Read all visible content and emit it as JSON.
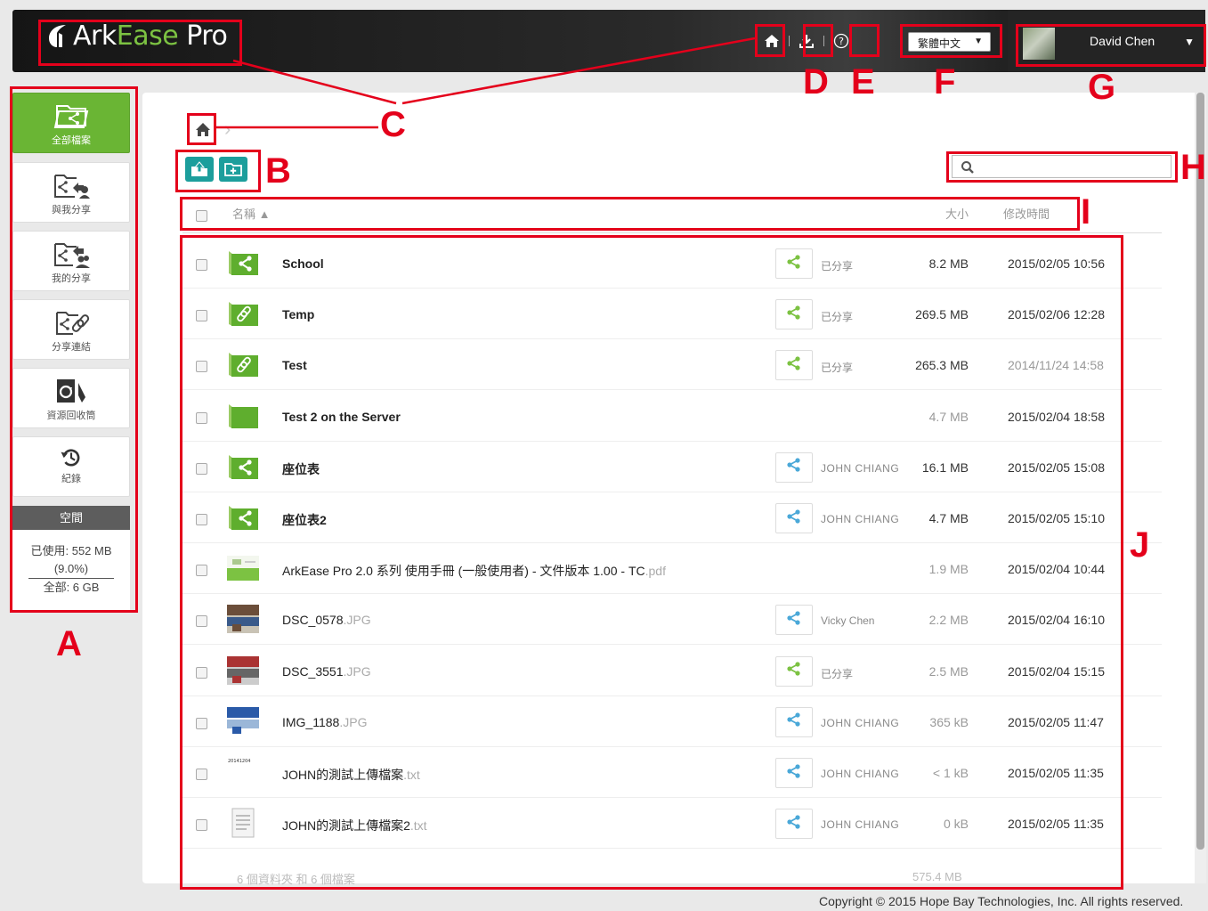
{
  "header": {
    "logo_text_a": "Ark",
    "logo_text_b": "Ease",
    "logo_text_c": "Pro",
    "language": "繁體中文",
    "user_name": "David Chen",
    "icons": [
      "home-icon",
      "download-icon",
      "help-icon"
    ]
  },
  "sidebar": {
    "items": [
      {
        "label": "全部檔案",
        "icon": "all-files-icon"
      },
      {
        "label": "與我分享",
        "icon": "shared-with-me-icon"
      },
      {
        "label": "我的分享",
        "icon": "my-shares-icon"
      },
      {
        "label": "分享連結",
        "icon": "share-links-icon"
      },
      {
        "label": "資源回收筒",
        "icon": "recycle-bin-icon"
      },
      {
        "label": "紀錄",
        "icon": "history-icon"
      }
    ],
    "space": {
      "title": "空間",
      "used": "已使用: 552 MB",
      "percent": "(9.0%)",
      "total": "全部: 6 GB"
    }
  },
  "table": {
    "col_name": "名稱 ▲",
    "col_size": "大小",
    "col_modified": "修改時間",
    "rows": [
      {
        "name": "School",
        "ext": "",
        "type": "shared-folder",
        "owner": "已分享",
        "size": "8.2 MB",
        "date": "2015/02/05 10:56"
      },
      {
        "name": "Temp",
        "ext": "",
        "type": "link-folder",
        "owner": "已分享",
        "size": "269.5 MB",
        "date": "2015/02/06 12:28"
      },
      {
        "name": "Test",
        "ext": "",
        "type": "link-folder",
        "owner": "已分享",
        "size": "265.3 MB",
        "date": "2014/11/24 14:58"
      },
      {
        "name": "Test 2 on the Server",
        "ext": "",
        "type": "folder",
        "owner": "",
        "size": "4.7 MB",
        "date": "2015/02/04 18:58"
      },
      {
        "name": "座位表",
        "ext": "",
        "type": "shared-folder",
        "owner": "JOHN CHIANG",
        "size": "16.1 MB",
        "date": "2015/02/05 15:08"
      },
      {
        "name": "座位表2",
        "ext": "",
        "type": "shared-folder",
        "owner": "JOHN CHIANG",
        "size": "4.7 MB",
        "date": "2015/02/05 15:10"
      },
      {
        "name": "ArkEase Pro 2.0 系列 使用手冊 (一般使用者) - 文件版本 1.00 - TC",
        "ext": ".pdf",
        "type": "pdf",
        "owner": "",
        "size": "1.9 MB",
        "date": "2015/02/04 10:44"
      },
      {
        "name": "DSC_0578",
        "ext": ".JPG",
        "type": "image",
        "owner": "Vicky Chen",
        "size": "2.2 MB",
        "date": "2015/02/04 16:10"
      },
      {
        "name": "DSC_3551",
        "ext": ".JPG",
        "type": "image",
        "owner": "已分享",
        "size": "2.5 MB",
        "date": "2015/02/04 15:15"
      },
      {
        "name": "IMG_1188",
        "ext": ".JPG",
        "type": "image",
        "owner": "JOHN CHIANG",
        "size": "365 kB",
        "date": "2015/02/05 11:47"
      },
      {
        "name": "JOHN的測試上傳檔案",
        "ext": ".txt",
        "type": "txt-thumb",
        "thumb_text": "20141204",
        "owner": "JOHN CHIANG",
        "size": "< 1 kB",
        "date": "2015/02/05 11:35"
      },
      {
        "name": "JOHN的測試上傳檔案2",
        "ext": ".txt",
        "type": "txt",
        "owner": "JOHN CHIANG",
        "size": "0 kB",
        "date": "2015/02/05 11:35"
      }
    ],
    "summary": "6 個資料夾 和 6 個檔案",
    "summary_size": "575.4 MB"
  },
  "footer": {
    "copyright": "Copyright © 2015 Hope Bay Technologies, Inc. All rights reserved."
  },
  "annotations": {
    "A": "A",
    "B": "B",
    "C": "C",
    "D": "D",
    "E": "E",
    "F": "F",
    "G": "G",
    "H": "H",
    "I": "I",
    "J": "J"
  },
  "colors": {
    "accent_green": "#6ab534",
    "teal": "#1c9e9c",
    "annotation_red": "#e4001b"
  }
}
